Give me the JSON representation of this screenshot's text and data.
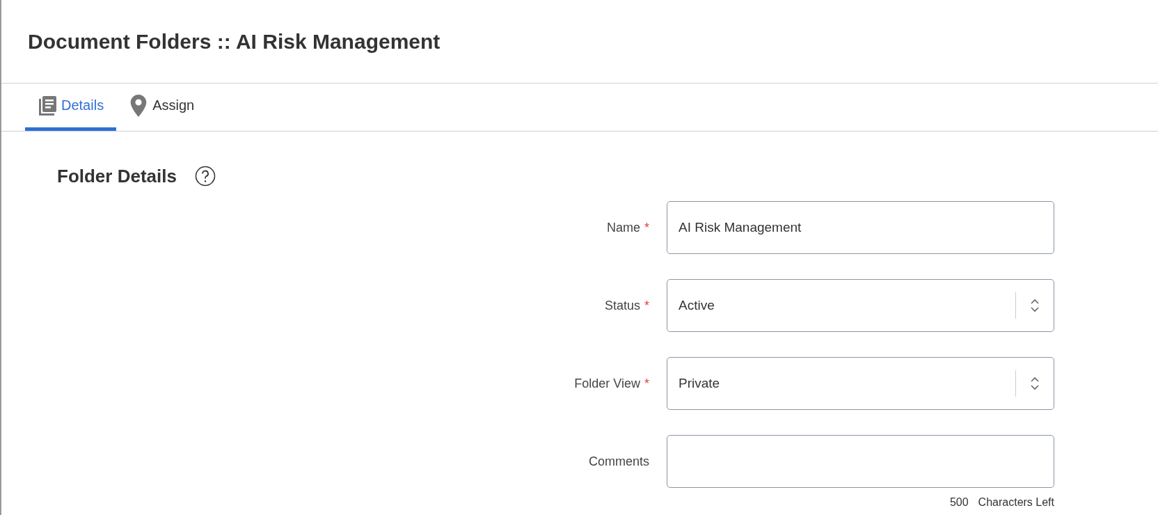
{
  "header": {
    "title": "Document Folders :: AI Risk Management"
  },
  "tabs": [
    {
      "label": "Details",
      "kind": "documents",
      "selected": true
    },
    {
      "label": "Assign",
      "kind": "location",
      "selected": false
    }
  ],
  "section": {
    "title": "Folder Details"
  },
  "fields": [
    {
      "label": "Name",
      "kind": "text",
      "required_mark": "*",
      "value": "AI Risk Management"
    },
    {
      "label": "Status",
      "kind": "select",
      "required_mark": "*",
      "value": "Active"
    },
    {
      "label": "Folder View",
      "kind": "select",
      "required_mark": "*",
      "value": "Private"
    },
    {
      "label": "Comments",
      "kind": "text"
    }
  ],
  "counter": {
    "count": "500",
    "label": "Characters Left"
  }
}
